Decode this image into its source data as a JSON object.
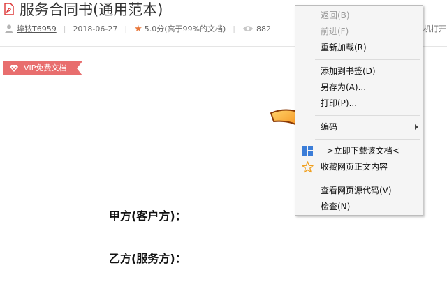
{
  "document": {
    "title": "服务合同书(通用范本)",
    "author": "埠铱T6959",
    "date": "2018-06-27",
    "rating": "5.0分(高于99%的文档)",
    "views": "882",
    "right_truncated": "机打开"
  },
  "vip_badge": {
    "label": "VIP免费文档"
  },
  "content": {
    "party_a": "甲方(客户方)：",
    "party_b": "乙方(服务方)："
  },
  "context_menu": {
    "back": "返回(B)",
    "forward": "前进(F)",
    "reload": "重新加载(R)",
    "bookmark": "添加到书签(D)",
    "save_as": "另存为(A)...",
    "print": "打印(P)...",
    "encoding": "编码",
    "download_doc": "-->立即下载该文档<--",
    "collect_text": "收藏网页正文内容",
    "view_source": "查看网页源代码(V)",
    "inspect": "检查(N)"
  },
  "colors": {
    "badge": "#e86e6e",
    "star": "#e8773b",
    "arrow": "#f28a1a",
    "download_icon": "#3b7dd8",
    "collect_icon": "#f0a020"
  }
}
